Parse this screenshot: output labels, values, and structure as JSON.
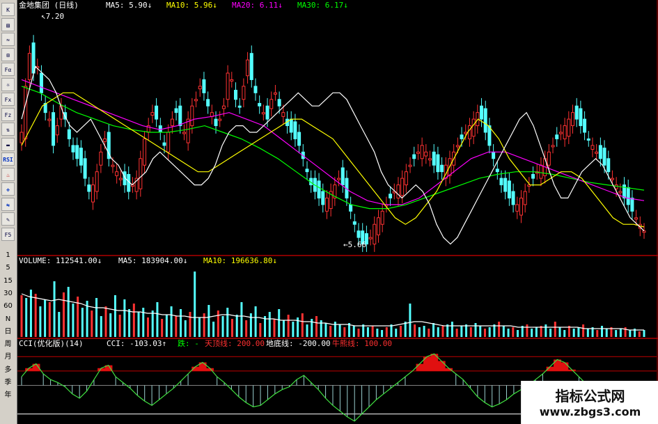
{
  "toolbar": {
    "buttons": [
      "K",
      "▤",
      "≈",
      "⊞",
      "Fα",
      "☼",
      "Fx",
      "Fz",
      "⇅",
      "▬",
      "RSI",
      "♨",
      "✥",
      "⇆",
      "✎",
      "F5"
    ],
    "periods": [
      "1",
      "5",
      "15",
      "30",
      "60",
      "N",
      "日",
      "周",
      "月",
      "多",
      "季",
      "年"
    ]
  },
  "price_panel": {
    "stock_name": "金地集团",
    "period": "(日线)",
    "indicators": [
      {
        "label": "MA5:",
        "value": "5.90",
        "arrow": "↓",
        "color": "#ffffff"
      },
      {
        "label": "MA10:",
        "value": "5.96",
        "arrow": "↓",
        "color": "#ffff00"
      },
      {
        "label": "MA20:",
        "value": "6.11",
        "arrow": "↓",
        "color": "#ff00ff"
      },
      {
        "label": "MA30:",
        "value": "6.17",
        "arrow": "↓",
        "color": "#00ff00"
      }
    ],
    "high_marker": "7.20",
    "low_marker": "5.66"
  },
  "volume_panel": {
    "items": [
      {
        "label": "VOLUME:",
        "value": "112541.00",
        "arrow": "↓",
        "color": "#ffffff"
      },
      {
        "label": "MA5:",
        "value": "183904.00",
        "arrow": "↓",
        "color": "#ffffff"
      },
      {
        "label": "MA10:",
        "value": "196636.80",
        "arrow": "↓",
        "color": "#ffff00"
      }
    ]
  },
  "cci_panel": {
    "name": "CCI(优化版)(14)",
    "items": [
      {
        "label": "CCI:",
        "value": "-103.03",
        "arrow": "↑",
        "color": "#ffffff"
      },
      {
        "label": "跌:",
        "value": "-",
        "arrow": "",
        "color": "#00ff00"
      },
      {
        "label": "天顶线:",
        "value": "200.00",
        "arrow": "",
        "color": "#ff3030"
      },
      {
        "label": "地底线:",
        "value": "-200.00",
        "arrow": "",
        "color": "#ffffff"
      },
      {
        "label": "牛熊线:",
        "value": "100.00",
        "arrow": "",
        "color": "#ff3030"
      }
    ]
  },
  "watermark": {
    "line1": "指标公式网",
    "line2": "www.zbgs3.com"
  },
  "colors": {
    "up": "#ff3232",
    "down": "#54ffff",
    "ma5": "#ffffff",
    "ma10": "#ffff00",
    "ma20": "#ff00ff",
    "ma30": "#00ff00",
    "frame": "#b00000"
  },
  "chart_data": {
    "type": "candlestick",
    "ylim": [
      5.5,
      7.3
    ],
    "close": [
      6.4,
      6.75,
      7.0,
      6.85,
      6.9,
      6.7,
      6.55,
      6.5,
      6.3,
      6.45,
      6.6,
      6.5,
      6.35,
      6.25,
      6.2,
      6.15,
      6.05,
      5.95,
      6.0,
      6.1,
      6.25,
      6.35,
      6.2,
      6.15,
      6.1,
      6.05,
      6.0,
      5.95,
      6.0,
      6.05,
      6.2,
      6.35,
      6.45,
      6.55,
      6.5,
      6.4,
      6.3,
      6.4,
      6.5,
      6.55,
      6.45,
      6.4,
      6.5,
      6.6,
      6.65,
      6.75,
      6.7,
      6.6,
      6.55,
      6.45,
      6.5,
      6.6,
      6.85,
      6.8,
      6.65,
      6.6,
      6.75,
      6.95,
      6.8,
      6.7,
      6.6,
      6.55,
      6.5,
      6.65,
      6.7,
      6.6,
      6.55,
      6.45,
      6.4,
      6.35,
      6.3,
      6.2,
      6.1,
      6.0,
      5.95,
      5.9,
      5.85,
      5.9,
      5.95,
      6.0,
      6.05,
      6.0,
      5.9,
      5.8,
      5.7,
      5.6,
      5.55,
      5.55,
      5.6,
      5.7,
      5.75,
      5.8,
      5.85,
      5.9,
      5.95,
      6.0,
      6.05,
      6.1,
      6.15,
      6.2,
      6.25,
      6.3,
      6.25,
      6.2,
      6.15,
      6.1,
      6.1,
      6.15,
      6.2,
      6.25,
      6.3,
      6.35,
      6.4,
      6.45,
      6.5,
      6.55,
      6.5,
      6.4,
      6.3,
      6.2,
      6.1,
      6.0,
      5.95,
      5.9,
      5.85,
      5.85,
      5.9,
      5.95,
      6.0,
      6.05,
      6.1,
      6.15,
      6.2,
      6.25,
      6.3,
      6.35,
      6.4,
      6.45,
      6.5,
      6.55,
      6.5,
      6.45,
      6.4,
      6.35,
      6.3,
      6.25,
      6.2,
      6.15,
      6.1,
      6.05,
      6.0,
      5.95,
      5.9,
      5.85,
      5.8,
      5.75,
      5.7,
      5.65
    ],
    "ma5": [
      6.5,
      6.7,
      6.9,
      6.85,
      6.8,
      6.7,
      6.55,
      6.45,
      6.4,
      6.45,
      6.5,
      6.4,
      6.3,
      6.2,
      6.15,
      6.05,
      6.0,
      6.05,
      6.1,
      6.2,
      6.25,
      6.2,
      6.15,
      6.1,
      6.05,
      6.0,
      6.0,
      6.05,
      6.15,
      6.3,
      6.4,
      6.45,
      6.45,
      6.4,
      6.4,
      6.45,
      6.5,
      6.55,
      6.6,
      6.65,
      6.7,
      6.65,
      6.6,
      6.6,
      6.65,
      6.7,
      6.7,
      6.65,
      6.55,
      6.45,
      6.35,
      6.25,
      6.1,
      6.0,
      5.95,
      5.9,
      5.95,
      6.0,
      5.95,
      5.85,
      5.7,
      5.6,
      5.55,
      5.6,
      5.7,
      5.8,
      5.9,
      6.0,
      6.1,
      6.2,
      6.3,
      6.4,
      6.5,
      6.55,
      6.45,
      6.3,
      6.15,
      6.0,
      5.9,
      5.9,
      6.0,
      6.1,
      6.15,
      6.2,
      6.15,
      6.05,
      5.95,
      5.85,
      5.75,
      5.7,
      5.65
    ],
    "ma10": [
      6.3,
      6.45,
      6.6,
      6.65,
      6.7,
      6.7,
      6.65,
      6.6,
      6.55,
      6.5,
      6.45,
      6.4,
      6.35,
      6.3,
      6.25,
      6.2,
      6.15,
      6.1,
      6.1,
      6.15,
      6.2,
      6.25,
      6.3,
      6.35,
      6.4,
      6.45,
      6.5,
      6.5,
      6.45,
      6.4,
      6.35,
      6.25,
      6.15,
      6.05,
      5.95,
      5.85,
      5.75,
      5.7,
      5.75,
      5.85,
      5.95,
      6.1,
      6.25,
      6.4,
      6.5,
      6.45,
      6.35,
      6.2,
      6.1,
      6.0,
      6.0,
      6.05,
      6.1,
      6.1,
      6.05,
      5.95,
      5.85,
      5.75,
      5.7,
      5.7,
      5.68
    ],
    "ma20": [
      6.8,
      6.75,
      6.7,
      6.65,
      6.6,
      6.55,
      6.5,
      6.45,
      6.42,
      6.45,
      6.5,
      6.52,
      6.55,
      6.5,
      6.45,
      6.35,
      6.25,
      6.15,
      6.05,
      5.95,
      5.88,
      5.85,
      5.85,
      5.9,
      6.0,
      6.1,
      6.2,
      6.25,
      6.25,
      6.2,
      6.15,
      6.1,
      6.05,
      6.0,
      5.95,
      5.9,
      5.88
    ],
    "ma30": [
      6.75,
      6.7,
      6.62,
      6.55,
      6.5,
      6.45,
      6.42,
      6.4,
      6.4,
      6.42,
      6.45,
      6.4,
      6.35,
      6.28,
      6.2,
      6.1,
      6.0,
      5.92,
      5.85,
      5.82,
      5.82,
      5.85,
      5.9,
      5.95,
      6.0,
      6.05,
      6.08,
      6.1,
      6.1,
      6.08,
      6.05,
      6.02,
      6.0,
      5.98,
      5.96
    ],
    "volume": [
      30,
      28,
      34,
      31,
      22,
      27,
      25,
      40,
      18,
      32,
      36,
      24,
      29,
      21,
      26,
      19,
      28,
      15,
      22,
      17,
      30,
      16,
      27,
      20,
      24,
      18,
      21,
      14,
      19,
      25,
      13,
      16,
      22,
      15,
      20,
      12,
      18,
      47,
      14,
      17,
      23,
      11,
      19,
      15,
      21,
      13,
      16,
      25,
      12,
      17,
      22,
      10,
      15,
      18,
      13,
      20,
      12,
      16,
      11,
      14,
      17,
      9,
      13,
      15,
      12,
      10,
      8,
      11,
      9,
      7,
      10,
      8,
      6,
      9,
      7,
      8,
      6,
      5,
      7,
      9,
      6,
      8,
      11,
      24,
      9,
      7,
      8,
      6,
      10,
      7,
      8,
      9,
      11,
      6,
      8,
      9,
      7,
      10,
      8,
      6,
      7,
      9,
      11,
      8,
      6,
      7,
      5,
      8,
      9,
      6,
      7,
      8,
      9,
      6,
      11,
      7,
      5,
      8,
      6,
      7,
      9,
      6,
      7,
      5,
      8,
      6,
      7,
      5,
      6,
      7,
      5,
      6,
      4,
      5
    ],
    "vol_ma5": [
      31,
      29,
      28,
      27,
      26,
      27,
      26,
      25,
      24,
      22,
      21,
      21,
      20,
      19,
      19,
      18,
      18,
      17,
      17,
      16,
      16,
      15,
      15,
      14,
      14,
      14,
      15,
      16,
      16,
      15,
      15,
      14,
      14,
      13,
      13,
      12,
      12,
      12,
      11,
      11,
      10,
      10,
      9,
      9,
      9,
      8,
      8,
      8,
      8,
      8,
      8,
      9,
      10,
      11,
      11,
      10,
      9,
      8,
      8,
      8,
      8,
      8,
      8,
      8,
      8,
      8,
      8,
      7,
      7,
      7,
      7,
      7,
      7,
      7,
      7,
      7,
      6,
      6,
      6,
      6,
      6,
      6,
      5,
      5,
      5
    ],
    "cci": [
      60,
      120,
      150,
      80,
      40,
      20,
      -10,
      -60,
      -90,
      -40,
      40,
      120,
      140,
      60,
      20,
      -20,
      -70,
      -110,
      -140,
      -100,
      -60,
      -20,
      30,
      80,
      130,
      160,
      120,
      60,
      20,
      -30,
      -80,
      -120,
      -150,
      -140,
      -100,
      -60,
      -30,
      -10,
      40,
      70,
      20,
      -30,
      -90,
      -140,
      -180,
      -220,
      -250,
      -200,
      -150,
      -100,
      -60,
      -20,
      20,
      60,
      100,
      150,
      200,
      220,
      170,
      120,
      80,
      40,
      -20,
      -80,
      -120,
      -150,
      -130,
      -100,
      -60,
      -30,
      0,
      40,
      80,
      130,
      180,
      160,
      110,
      60,
      10,
      -40,
      -80,
      -110,
      -140,
      -160,
      -120,
      -90,
      -103
    ],
    "cci_levels": {
      "top": 200,
      "bull_bear": 100,
      "bottom": -200
    }
  }
}
